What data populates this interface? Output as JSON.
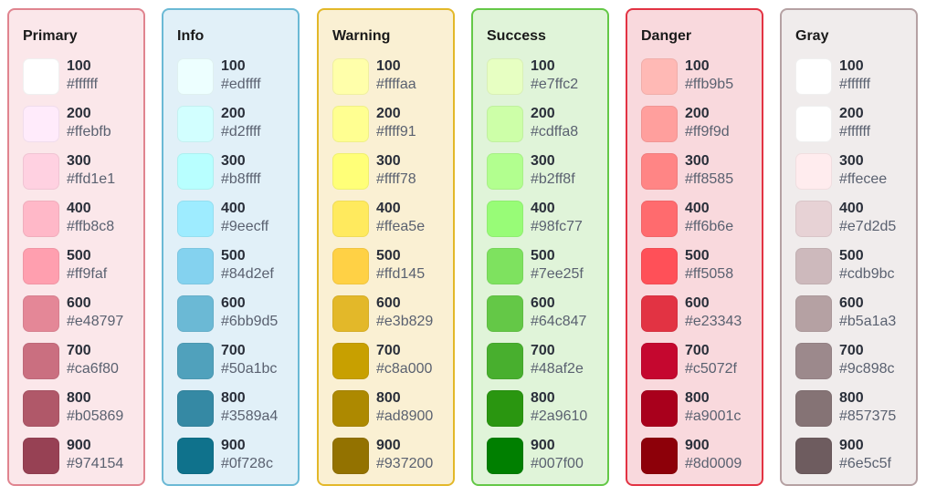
{
  "palettes": [
    {
      "name": "Primary",
      "border": "#e0848f",
      "bg": "#fbe7ea",
      "colors": [
        {
          "shade": "100",
          "hex": "#ffffff"
        },
        {
          "shade": "200",
          "hex": "#ffebfb"
        },
        {
          "shade": "300",
          "hex": "#ffd1e1"
        },
        {
          "shade": "400",
          "hex": "#ffb8c8"
        },
        {
          "shade": "500",
          "hex": "#ff9faf"
        },
        {
          "shade": "600",
          "hex": "#e48797"
        },
        {
          "shade": "700",
          "hex": "#ca6f80"
        },
        {
          "shade": "800",
          "hex": "#b05869"
        },
        {
          "shade": "900",
          "hex": "#974154"
        }
      ]
    },
    {
      "name": "Info",
      "border": "#6bb9d5",
      "bg": "#e1f0f8",
      "colors": [
        {
          "shade": "100",
          "hex": "#edffff"
        },
        {
          "shade": "200",
          "hex": "#d2ffff"
        },
        {
          "shade": "300",
          "hex": "#b8ffff"
        },
        {
          "shade": "400",
          "hex": "#9eecff"
        },
        {
          "shade": "500",
          "hex": "#84d2ef"
        },
        {
          "shade": "600",
          "hex": "#6bb9d5"
        },
        {
          "shade": "700",
          "hex": "#50a1bc"
        },
        {
          "shade": "800",
          "hex": "#3589a4"
        },
        {
          "shade": "900",
          "hex": "#0f728c"
        }
      ]
    },
    {
      "name": "Warning",
      "border": "#e3b829",
      "bg": "#faf0d3",
      "colors": [
        {
          "shade": "100",
          "hex": "#ffffaa"
        },
        {
          "shade": "200",
          "hex": "#ffff91"
        },
        {
          "shade": "300",
          "hex": "#ffff78"
        },
        {
          "shade": "400",
          "hex": "#ffea5e"
        },
        {
          "shade": "500",
          "hex": "#ffd145"
        },
        {
          "shade": "600",
          "hex": "#e3b829"
        },
        {
          "shade": "700",
          "hex": "#c8a000"
        },
        {
          "shade": "800",
          "hex": "#ad8900"
        },
        {
          "shade": "900",
          "hex": "#937200"
        }
      ]
    },
    {
      "name": "Success",
      "border": "#64c847",
      "bg": "#e0f4d9",
      "colors": [
        {
          "shade": "100",
          "hex": "#e7ffc2"
        },
        {
          "shade": "200",
          "hex": "#cdffa8"
        },
        {
          "shade": "300",
          "hex": "#b2ff8f"
        },
        {
          "shade": "400",
          "hex": "#98fc77"
        },
        {
          "shade": "500",
          "hex": "#7ee25f"
        },
        {
          "shade": "600",
          "hex": "#64c847"
        },
        {
          "shade": "700",
          "hex": "#48af2e"
        },
        {
          "shade": "800",
          "hex": "#2a9610"
        },
        {
          "shade": "900",
          "hex": "#007f00"
        }
      ]
    },
    {
      "name": "Danger",
      "border": "#e23343",
      "bg": "#f9d9dd",
      "colors": [
        {
          "shade": "100",
          "hex": "#ffb9b5"
        },
        {
          "shade": "200",
          "hex": "#ff9f9d"
        },
        {
          "shade": "300",
          "hex": "#ff8585"
        },
        {
          "shade": "400",
          "hex": "#ff6b6e"
        },
        {
          "shade": "500",
          "hex": "#ff5058"
        },
        {
          "shade": "600",
          "hex": "#e23343"
        },
        {
          "shade": "700",
          "hex": "#c5072f"
        },
        {
          "shade": "800",
          "hex": "#a9001c"
        },
        {
          "shade": "900",
          "hex": "#8d0009"
        }
      ]
    },
    {
      "name": "Gray",
      "border": "#b5a1a3",
      "bg": "#f0ecec",
      "colors": [
        {
          "shade": "100",
          "hex": "#ffffff"
        },
        {
          "shade": "200",
          "hex": "#ffffff"
        },
        {
          "shade": "300",
          "hex": "#ffecee"
        },
        {
          "shade": "400",
          "hex": "#e7d2d5"
        },
        {
          "shade": "500",
          "hex": "#cdb9bc"
        },
        {
          "shade": "600",
          "hex": "#b5a1a3"
        },
        {
          "shade": "700",
          "hex": "#9c898c"
        },
        {
          "shade": "800",
          "hex": "#857375"
        },
        {
          "shade": "900",
          "hex": "#6e5c5f"
        }
      ]
    }
  ]
}
